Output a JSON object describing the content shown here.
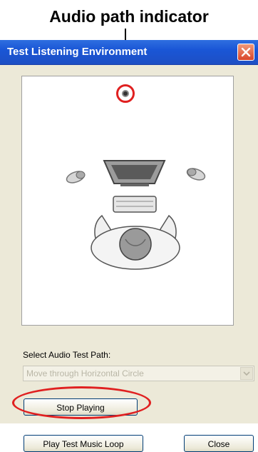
{
  "callout": {
    "text": "Audio path indicator"
  },
  "window": {
    "title": "Test Listening Environment",
    "select_label": "Select Audio Test Path:",
    "select_value": "Move through Horizontal Circle",
    "buttons": {
      "stop": "Stop Playing",
      "play_loop": "Play Test Music Loop",
      "close": "Close"
    }
  },
  "colors": {
    "titlebar": "#1a56d6",
    "highlight": "#e02020",
    "window_bg": "#ece9d8"
  },
  "icons": {
    "close": "close-x-icon",
    "indicator": "audio-path-indicator-icon",
    "dropdown": "chevron-down-icon"
  }
}
